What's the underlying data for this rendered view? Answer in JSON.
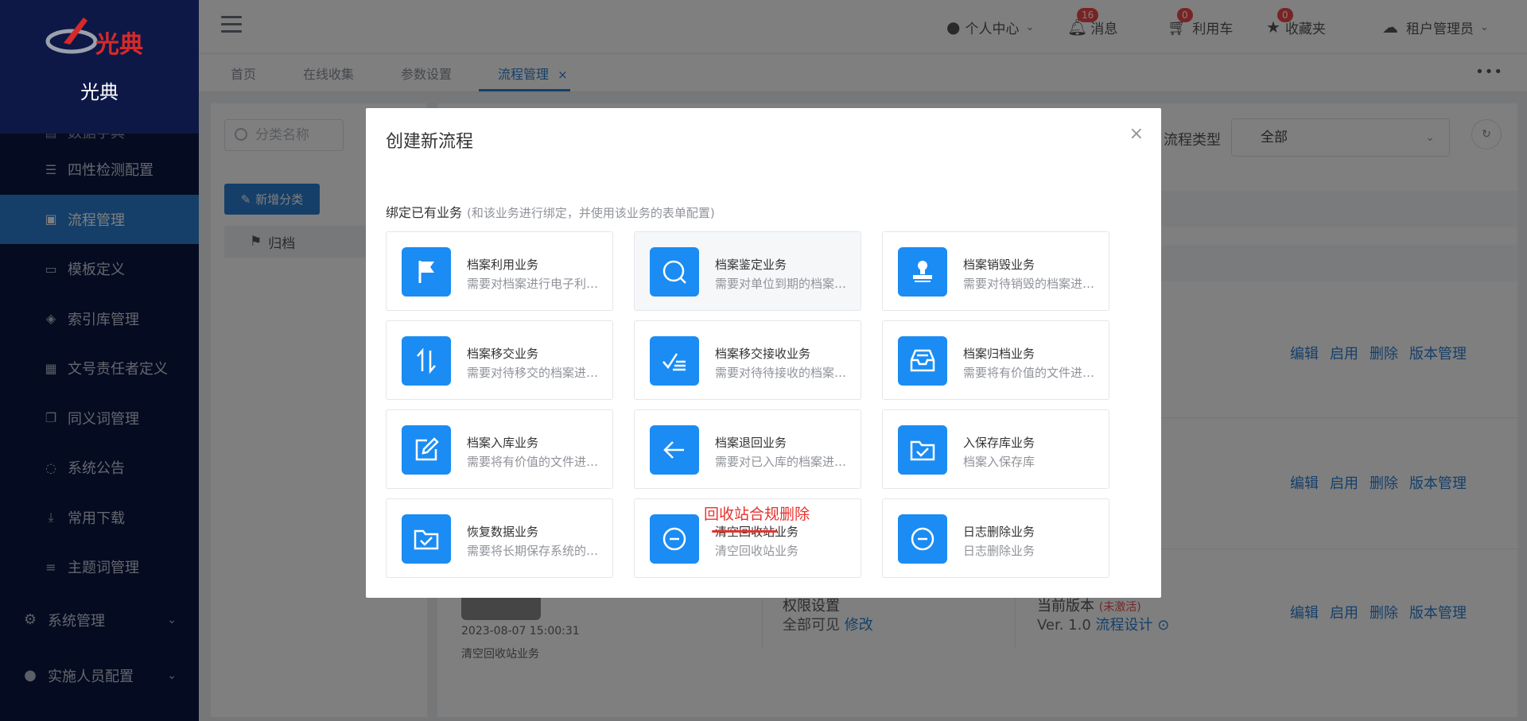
{
  "brand": {
    "logo_text": "光典",
    "title": "光典"
  },
  "sidebar": {
    "partial_item": "数据字典",
    "items": [
      {
        "label": "四性检测配置",
        "icon": "sliders-icon"
      },
      {
        "label": "流程管理",
        "icon": "process-icon",
        "active": true
      },
      {
        "label": "模板定义",
        "icon": "template-icon"
      },
      {
        "label": "索引库管理",
        "icon": "layers-icon"
      },
      {
        "label": "文号责任者定义",
        "icon": "grid-icon"
      },
      {
        "label": "同义词管理",
        "icon": "copy-icon"
      },
      {
        "label": "系统公告",
        "icon": "chat-icon"
      },
      {
        "label": "常用下载",
        "icon": "download-icon"
      },
      {
        "label": "主题词管理",
        "icon": "list-icon"
      }
    ],
    "groups": [
      {
        "label": "系统管理",
        "icon": "gear-icon"
      },
      {
        "label": "实施人员配置",
        "icon": "user-icon"
      }
    ]
  },
  "header": {
    "user_center": "个人中心",
    "messages": "消息",
    "messages_count": "16",
    "cart": "利用车",
    "cart_count": "0",
    "favorites": "收藏夹",
    "favorites_count": "0",
    "tenant": "租户管理员"
  },
  "tabs": [
    {
      "label": "首页"
    },
    {
      "label": "在线收集"
    },
    {
      "label": "参数设置"
    },
    {
      "label": "流程管理",
      "active": true,
      "close": "×"
    }
  ],
  "left_panel": {
    "search_placeholder": "分类名称",
    "add_button": "新增分类",
    "tree_item": "归档"
  },
  "filter": {
    "label": "流程类型",
    "value": "全部"
  },
  "row_actions": {
    "edit": "编辑",
    "enable": "启用",
    "delete": "删除",
    "versions": "版本管理"
  },
  "last_row": {
    "date": "2023-08-07 15:00:31",
    "name": "清空回收站业务",
    "perm_title": "权限设置",
    "perm_value": "全部可见",
    "perm_link": "修改",
    "version_title": "当前版本",
    "version_status": "(未激活)",
    "version_value": "Ver. 1.0",
    "design_link": "流程设计"
  },
  "modal": {
    "title": "创建新流程",
    "close": "×",
    "section": "绑定已有业务",
    "section_note": "(和该业务进行绑定，并使用该业务的表单配置)",
    "annotation": "回收站合规删除",
    "cards": [
      {
        "name": "档案利用业务",
        "desc": "需要对档案进行电子利用的业务",
        "icon": "flag-icon"
      },
      {
        "name": "档案鉴定业务",
        "desc": "需要对单位到期的档案进行鉴定",
        "icon": "search-icon"
      },
      {
        "name": "档案销毁业务",
        "desc": "需要对待销毁的档案进行销毁",
        "icon": "stamp-icon"
      },
      {
        "name": "档案移交业务",
        "desc": "需要对待移交的档案进行移交",
        "icon": "transfer-icon"
      },
      {
        "name": "档案移交接收业务",
        "desc": "需要对待待接收的档案进行接收",
        "icon": "checklist-icon"
      },
      {
        "name": "档案归档业务",
        "desc": "需要将有价值的文件进行归档",
        "icon": "inbox-icon"
      },
      {
        "name": "档案入库业务",
        "desc": "需要将有价值的文件进行入库",
        "icon": "edit-icon"
      },
      {
        "name": "档案退回业务",
        "desc": "需要对已入库的档案进行退回",
        "icon": "arrow-left-icon"
      },
      {
        "name": "入保存库业务",
        "desc": "档案入保存库",
        "icon": "folder-check-icon"
      },
      {
        "name": "恢复数据业务",
        "desc": "需要将长期保存系统的数据恢复",
        "icon": "folder-check-icon"
      },
      {
        "name": "清空回收站业务",
        "desc": "清空回收站业务",
        "icon": "minus-circle-icon"
      },
      {
        "name": "日志删除业务",
        "desc": "日志删除业务",
        "icon": "minus-circle-icon"
      }
    ]
  }
}
